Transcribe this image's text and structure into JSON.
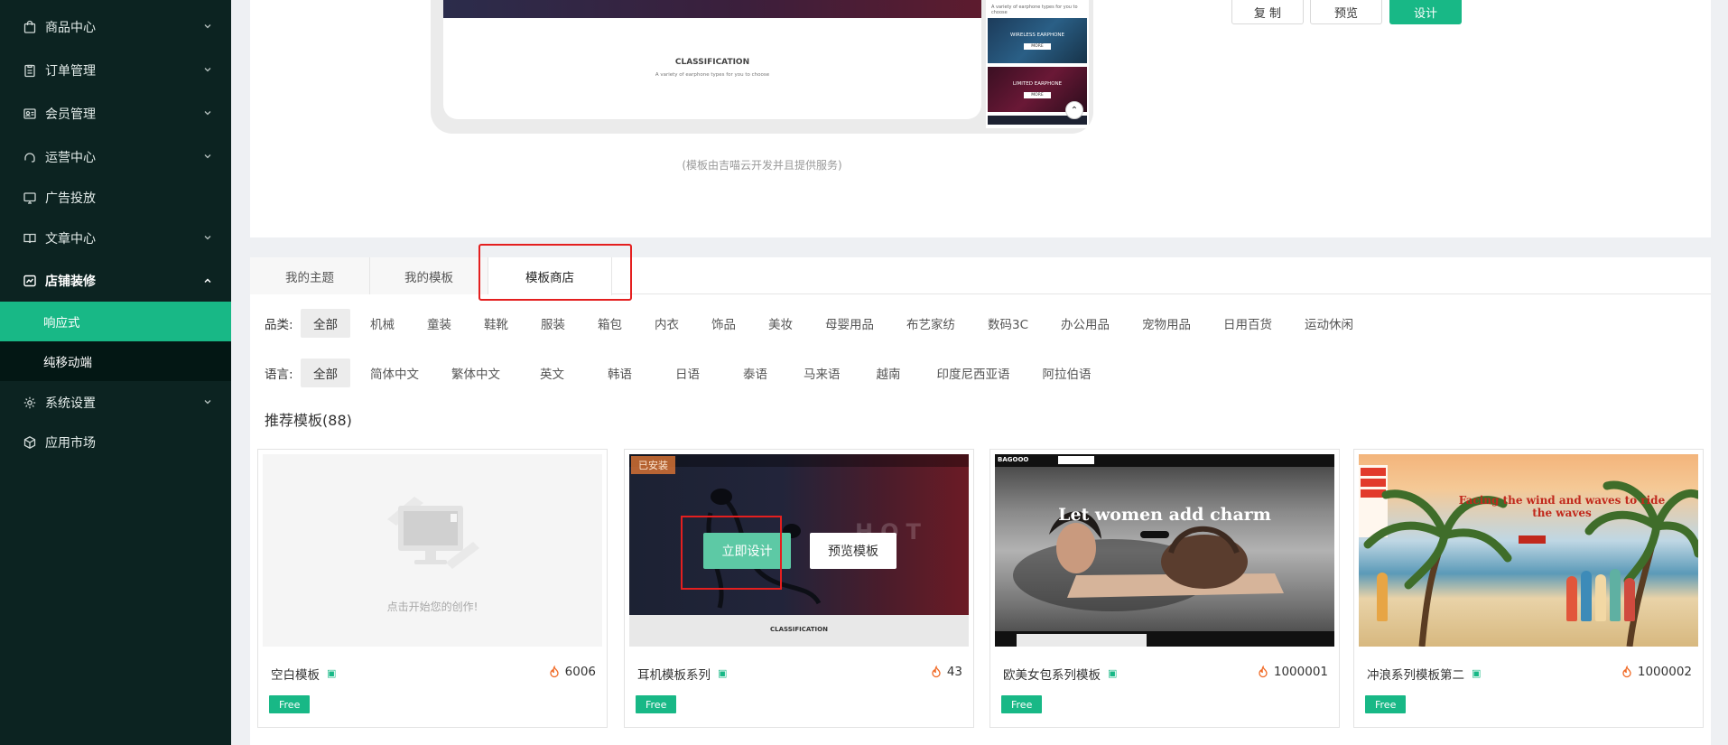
{
  "sidebar": {
    "items": [
      {
        "label": "商品中心",
        "icon": "shopping-bag-icon",
        "expandable": true
      },
      {
        "label": "订单管理",
        "icon": "clipboard-icon",
        "expandable": true
      },
      {
        "label": "会员管理",
        "icon": "member-card-icon",
        "expandable": true
      },
      {
        "label": "运营中心",
        "icon": "operations-icon",
        "expandable": true
      },
      {
        "label": "广告投放",
        "icon": "monitor-icon",
        "expandable": false
      },
      {
        "label": "文章中心",
        "icon": "book-icon",
        "expandable": true
      },
      {
        "label": "店铺装修",
        "icon": "shop-decor-icon",
        "expandable": true,
        "expanded": true
      },
      {
        "label": "系统设置",
        "icon": "gear-icon",
        "expandable": true
      },
      {
        "label": "应用市场",
        "icon": "cube-icon",
        "expandable": false
      }
    ],
    "sub_items": [
      {
        "label": "响应式",
        "selected": true
      },
      {
        "label": "纯移动端",
        "selected": false
      }
    ]
  },
  "top_panel": {
    "preview": {
      "section_title": "CLASSIFICATION",
      "section_subtitle": "A variety of earphone types for you to choose",
      "side_caption": "A variety of earphone types for you to choose",
      "card1_title": "WIRELESS EARPHONE",
      "card2_title": "LIMITED EARPHONE",
      "card_button": "MORE"
    },
    "provider_note": "(模板由吉喵云开发并且提供服务)",
    "buttons": {
      "copy": "复 制",
      "preview": "预览",
      "design": "设计"
    }
  },
  "tabs": [
    {
      "label": "我的主题",
      "active": false
    },
    {
      "label": "我的模板",
      "active": false
    },
    {
      "label": "模板商店",
      "active": true
    }
  ],
  "filters": {
    "category_label": "品类:",
    "categories": [
      "全部",
      "机械",
      "童装",
      "鞋靴",
      "服装",
      "箱包",
      "内衣",
      "饰品",
      "美妆",
      "母婴用品",
      "布艺家纺",
      "数码3C",
      "办公用品",
      "宠物用品",
      "日用百货",
      "运动休闲"
    ],
    "category_selected": "全部",
    "language_label": "语言:",
    "languages": [
      "全部",
      "简体中文",
      "繁体中文",
      "英文",
      "韩语",
      "日语",
      "泰语",
      "马来语",
      "越南",
      "印度尼西亚语",
      "阿拉伯语"
    ],
    "language_selected": "全部"
  },
  "recommended": {
    "title": "推荐模板",
    "count": "(88)"
  },
  "templates": [
    {
      "name": "空白模板",
      "count": "6006",
      "badge": "Free",
      "thumb_text": "点击开始您的创作!"
    },
    {
      "name": "耳机模板系列",
      "count": "43",
      "badge": "Free",
      "installed_label": "已安装",
      "hero_text": "HOT",
      "footer_text": "CLASSIFICATION",
      "design_button": "立即设计",
      "preview_button": "预览模板"
    },
    {
      "name": "欧美女包系列模板",
      "count": "1000001",
      "badge": "Free",
      "brand": "BAGOOO",
      "headline": "Let women add charm"
    },
    {
      "name": "冲浪系列模板第二",
      "count": "1000002",
      "badge": "Free",
      "headline": "Facing the wind and waves to ride the waves"
    }
  ],
  "colors": {
    "sidebar_bg": "#0c2321",
    "accent": "#18b886",
    "highlight_border": "#e41f1f"
  }
}
